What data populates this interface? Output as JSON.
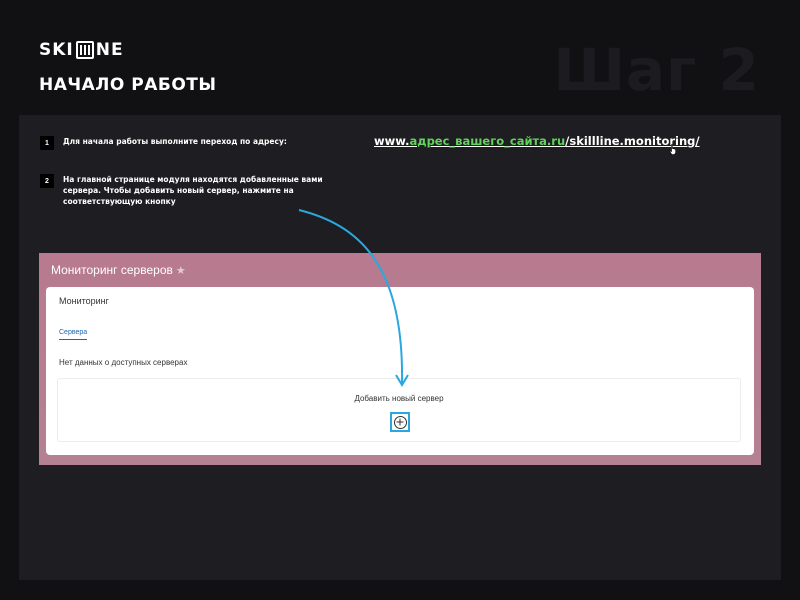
{
  "header": {
    "logo_left": "SKI",
    "logo_right": "NE",
    "section_title": "НАЧАЛО РАБОТЫ",
    "step_watermark": "Шаг 2"
  },
  "steps": [
    {
      "number": "1",
      "text": "Для начала работы выполните переход по адресу:"
    },
    {
      "number": "2",
      "text": "На главной странице модуля находятся добавленные вами сервера. Чтобы добавить новый сервер, нажмите на соответствующую кнопку"
    }
  ],
  "url": {
    "prefix": "www.",
    "site": "адрес_вашего_сайта.ru",
    "path": "/skillline.monitoring/"
  },
  "module": {
    "page_title": "Мониторинг серверов",
    "card_title": "Мониторинг",
    "tab_servers": "Сервера",
    "empty_message": "Нет данных о доступных серверах",
    "add_label": "Добавить новый сервер"
  },
  "icons": {
    "star": "star-icon",
    "plus": "plus-icon",
    "cursor": "hand-cursor-icon",
    "arrow": "curved-arrow"
  },
  "colors": {
    "background": "#111114",
    "panel": "#1e1e22",
    "accent_green": "#62d35a",
    "accent_blue": "#29a8e0",
    "screenshot_header": "#b77a8e"
  }
}
